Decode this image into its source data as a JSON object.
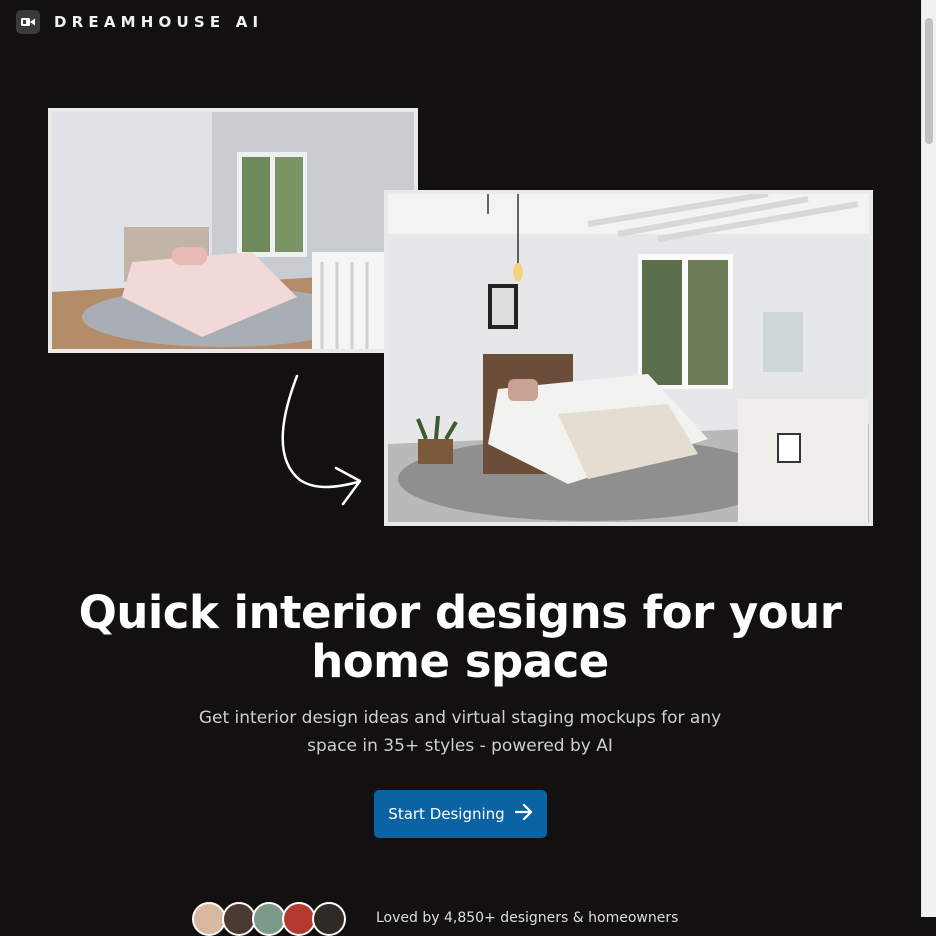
{
  "header": {
    "brand": "DREAMHOUSE AI",
    "logo_icon": "video-camera-logo-icon"
  },
  "images": {
    "before_alt": "Empty bedroom before staging",
    "after_alt": "Staged bedroom after AI design"
  },
  "hero": {
    "title": "Quick interior designs for your home space",
    "subtitle": "Get interior design ideas and virtual staging mockups for any space in 35+ styles - powered by AI"
  },
  "cta": {
    "label": "Start Designing",
    "icon": "arrow-right-icon",
    "color": "#0c63a3"
  },
  "social_proof": {
    "text": "Loved by 4,850+ designers & homeowners"
  },
  "colors": {
    "background": "#121011",
    "accent": "#0c63a3"
  }
}
